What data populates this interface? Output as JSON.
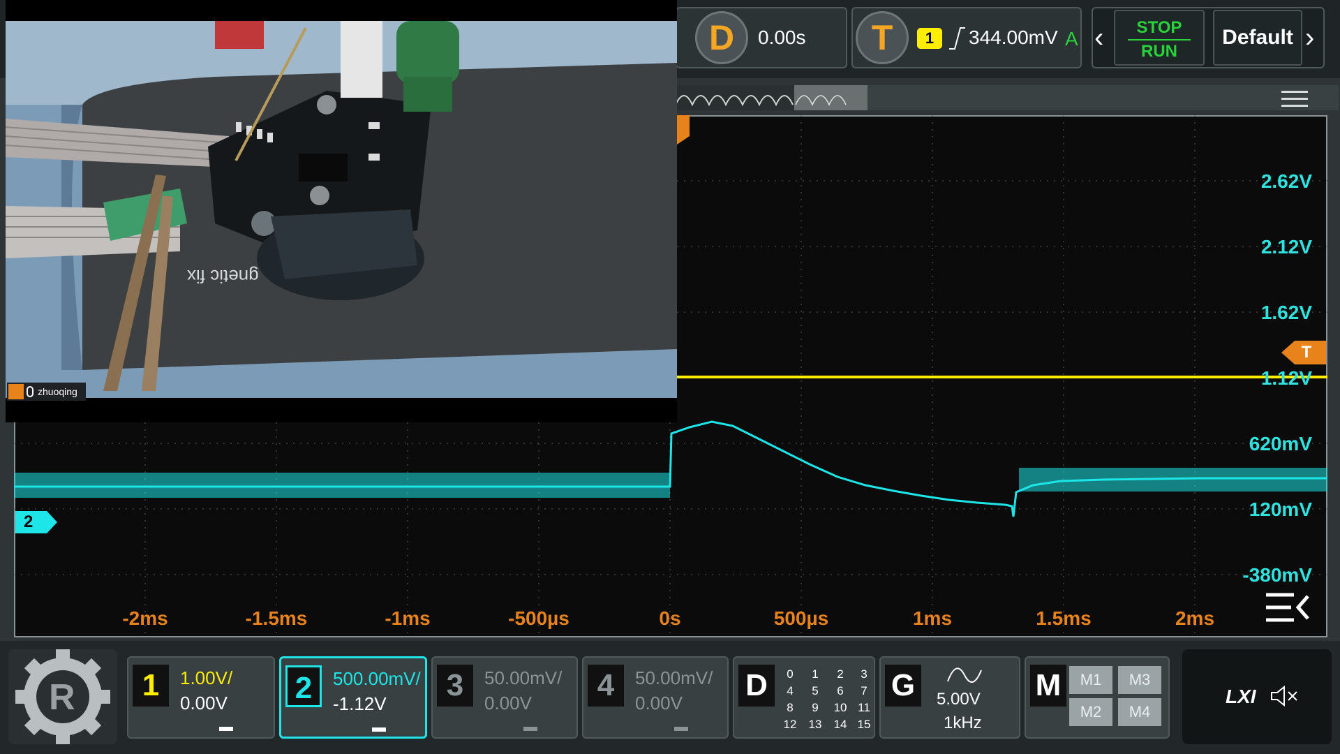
{
  "top_bar": {
    "delay": {
      "icon_label": "D",
      "value": "0.00s"
    },
    "trigger": {
      "icon_label": "T",
      "source": "1",
      "level": "344.00mV",
      "mode": "A"
    },
    "stop_label": "STOP",
    "run_label": "RUN",
    "default_label": "Default"
  },
  "camera": {
    "username": "zhuoqing",
    "case_text": "gnetic fix"
  },
  "voltage_labels": [
    "2.62V",
    "2.12V",
    "1.62V",
    "1.12V",
    "620mV",
    "120mV",
    "-380mV"
  ],
  "time_labels": [
    "-2ms",
    "-1.5ms",
    "-1ms",
    "-500µs",
    "0s",
    "500µs",
    "1ms",
    "1.5ms",
    "2ms"
  ],
  "markers": {
    "trigger": "T",
    "channel2": "2"
  },
  "channels": [
    {
      "number": "1",
      "scale": "1.00V/",
      "offset": "0.00V",
      "color": "#ffee00"
    },
    {
      "number": "2",
      "scale": "500.00mV/",
      "offset": "-1.12V",
      "color": "#1ee6e8"
    },
    {
      "number": "3",
      "scale": "50.00mV/",
      "offset": "0.00V",
      "color": "#8a9496"
    },
    {
      "number": "4",
      "scale": "50.00mV/",
      "offset": "0.00V",
      "color": "#8a9496"
    }
  ],
  "digital": {
    "label": "D",
    "channels": [
      "0",
      "1",
      "2",
      "3",
      "4",
      "5",
      "6",
      "7",
      "8",
      "9",
      "10",
      "11",
      "12",
      "13",
      "14",
      "15"
    ]
  },
  "generator": {
    "label": "G",
    "amplitude": "5.00V",
    "frequency": "1kHz"
  },
  "math": {
    "label": "M",
    "buttons": [
      "M1",
      "M3",
      "M2",
      "M4"
    ]
  },
  "lxi_label": "LXI",
  "colors": {
    "ch1": "#ffee00",
    "ch2": "#1ee6e8",
    "timebase": "#e8831c",
    "stop": "#29d33a"
  }
}
